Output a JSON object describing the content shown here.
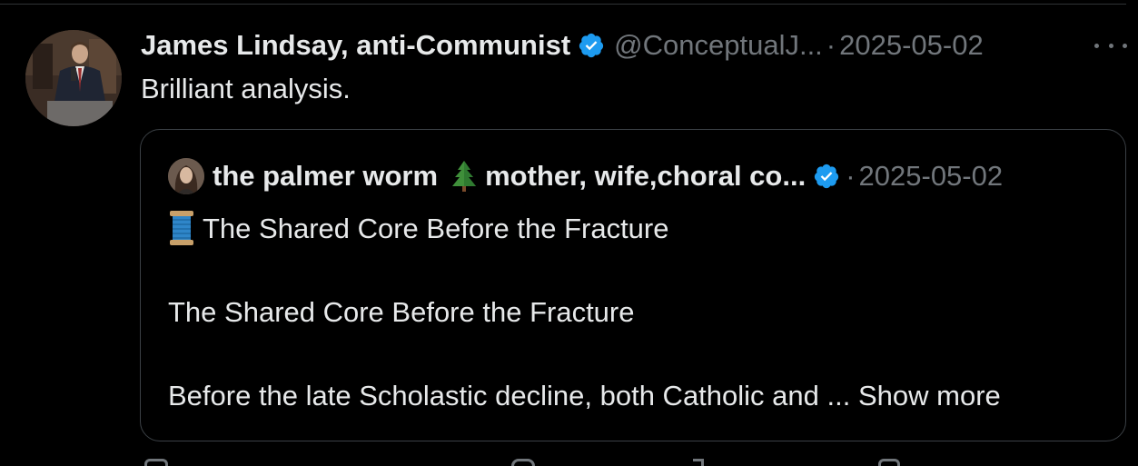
{
  "post": {
    "author_name": "James Lindsay, anti-Communist",
    "handle": "@ConceptualJ...",
    "separator": "·",
    "timestamp": "2025-05-02",
    "text": "Brilliant analysis.",
    "verified": true
  },
  "quote": {
    "author_name": "the palmer worm",
    "tree_emoji": "tree-icon",
    "bio_snippet": "mother, wife,choral co...",
    "separator": "·",
    "timestamp": "2025-05-02",
    "verified": true,
    "title_line": "The Shared Core Before the Fracture",
    "line2": "The Shared Core Before the Fracture",
    "line3": "Before the late Scholastic decline, both Catholic and ...",
    "show_more": "Show more"
  },
  "colors": {
    "background": "#000000",
    "text_primary": "#e7e9ea",
    "text_secondary": "#71767b",
    "verified_blue": "#1d9bf0",
    "border": "#3b4045"
  },
  "icons": {
    "more": "more-horizontal-icon",
    "verified": "verified-badge-icon",
    "spool": "spool-of-thread-icon",
    "tree": "evergreen-tree-icon"
  }
}
